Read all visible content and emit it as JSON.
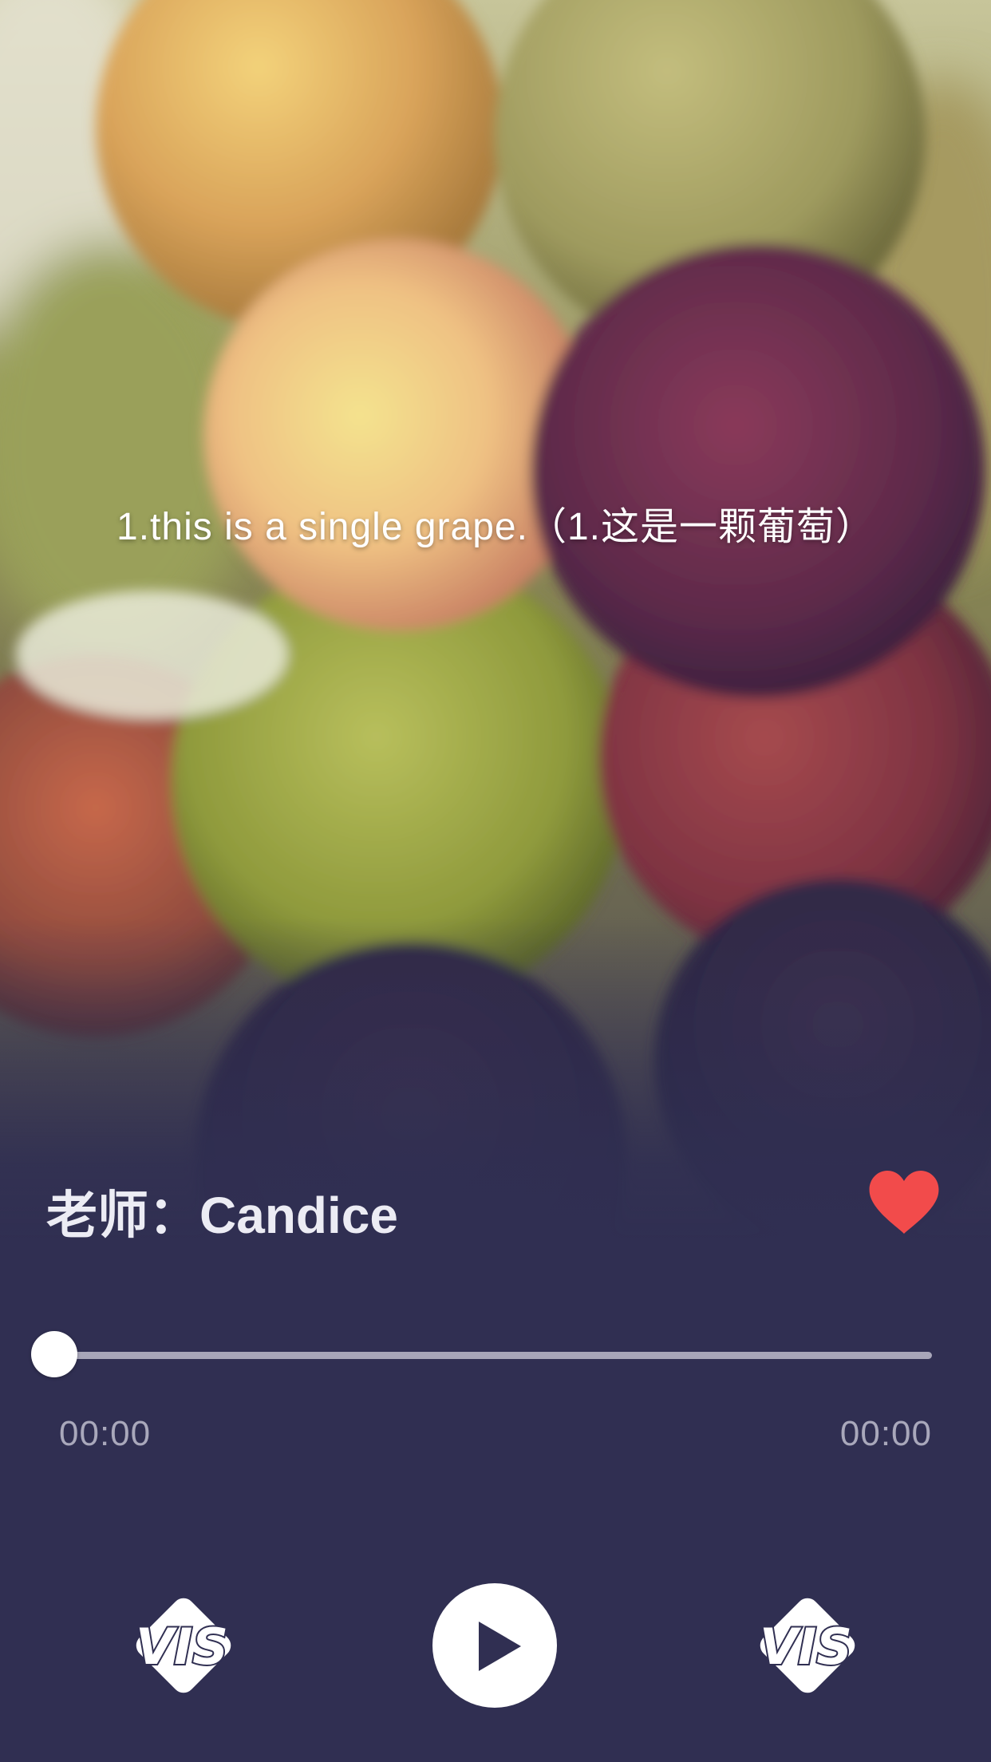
{
  "lesson": {
    "subtitle": "1.this is a single grape.（1.这是一颗葡萄）",
    "background_image": "grapes-photo"
  },
  "teacher": {
    "label": "老师：",
    "name": "Candice"
  },
  "favorite": {
    "icon": "heart-icon",
    "active": true,
    "color": "#f24b4b"
  },
  "player": {
    "progress": 0,
    "current_time": "00:00",
    "duration": "00:00",
    "controls": {
      "previous_icon": "vis-logo-icon",
      "play_icon": "play-icon",
      "next_icon": "vis-logo-icon"
    }
  },
  "colors": {
    "background": "#302f52",
    "track": "#a8a6b9",
    "time_text": "#a9a8bb",
    "heart": "#f24b4b"
  }
}
